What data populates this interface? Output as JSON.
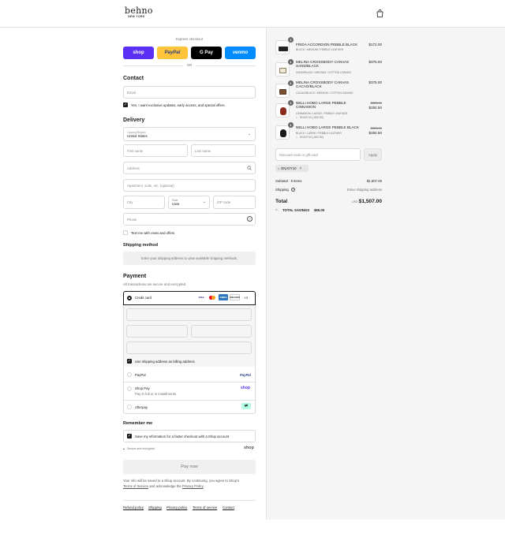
{
  "header": {
    "logo_main": "behno",
    "logo_sub": "NEW YORK",
    "cart_icon": "shopping-bag-icon"
  },
  "express": {
    "title": "Express checkout",
    "buttons": [
      {
        "label": "shop",
        "bg": "#5a31f4",
        "fg": "#ffffff"
      },
      {
        "label": "PayPal",
        "bg": "#ffc439",
        "fg": "#253b80"
      },
      {
        "label": "G Pay",
        "bg": "#000000",
        "fg": "#ffffff"
      },
      {
        "label": "venmo",
        "bg": "#008cff",
        "fg": "#ffffff"
      }
    ],
    "or": "OR"
  },
  "contact": {
    "title": "Contact",
    "email_placeholder": "Email",
    "offers_label": "Yes, I want exclusive updates, early access, and special offers."
  },
  "delivery": {
    "title": "Delivery",
    "country_label": "Country/Region",
    "country_value": "United States",
    "first_name": "First name",
    "last_name": "Last name",
    "address": "Address",
    "apartment": "Apartment, suite, etc. (optional)",
    "city": "City",
    "state_label": "State",
    "state_value": "Iowa",
    "zip": "ZIP code",
    "phone": "Phone",
    "sms_label": "Text me with news and offers"
  },
  "shipping_method": {
    "title": "Shipping method",
    "message": "Enter your shipping address to view available shipping methods."
  },
  "payment": {
    "title": "Payment",
    "subtitle": "All transactions are secure and encrypted.",
    "credit_card": "Credit card",
    "card_logos": [
      "VISA",
      "MC",
      "AMEX",
      "DISCOVER"
    ],
    "more_cards": "+4",
    "billing_label": "Use shipping address as billing address",
    "paypal": "PayPal",
    "paypal_logo": "PayPal",
    "shoppay": "Shop Pay",
    "shoppay_sub": "Pay in full or in installments",
    "shoppay_logo": "shop",
    "afterpay": "Afterpay"
  },
  "remember": {
    "title": "Remember me",
    "save_label": "Save my information for a faster checkout with a Shop account",
    "secure": "Secure and encrypted",
    "shop_logo": "shop"
  },
  "pay_now": "Pay now",
  "legal": {
    "line1": "Your info will be saved to a Shop account. By continuing, you agree to Shop's",
    "terms": "Terms of Service",
    "and": "and acknowledge the",
    "privacy": "Privacy Policy",
    "dot": "."
  },
  "footer": [
    "Refund policy",
    "Shipping",
    "Privacy policy",
    "Terms of service",
    "Contact"
  ],
  "items": [
    {
      "qty": "1",
      "name": "FRIDA ACCORDION PEBBLE BLACK",
      "variant": "BLACK / MEDIUM / PEBBLE LEATHER",
      "price": "$172.00",
      "orig": "",
      "discount": ""
    },
    {
      "qty": "1",
      "name": "MELINA CROSSBODY CANVAS SAND/BLACK",
      "variant": "SAND/BLACK / MEDIUM / COTTON CANVAS",
      "price": "$375.00",
      "orig": "",
      "discount": ""
    },
    {
      "qty": "1",
      "name": "MELINA CROSSBODY CANVAS CACAO/BLACK",
      "variant": "CACAO/BLACK / MEDIUM / COTTON CANVAS",
      "price": "$375.00",
      "orig": "",
      "discount": ""
    },
    {
      "qty": "1",
      "name": "NELLI HOBO LARGE PEBBLE CINNAMON",
      "variant": "CINNAMON / LARGE / PEBBLE LEATHER",
      "price": "$292.50",
      "orig": "$325.00",
      "discount": "ENJOY10 (-$32.50)"
    },
    {
      "qty": "1",
      "name": "NELLI HOBO LARGE PEBBLE BLACK",
      "variant": "BLACK / LARGE / PEBBLE LEATHER",
      "price": "$292.50",
      "orig": "$325.00",
      "discount": "ENJOY10 (-$32.50)"
    }
  ],
  "discount": {
    "placeholder": "Discount code or gift card",
    "apply": "Apply",
    "tag": "ENJOY10"
  },
  "summary": {
    "subtotal_label": "Subtotal · 5 items",
    "subtotal": "$1,507.00",
    "shipping_label": "Shipping",
    "shipping_value": "Enter shipping address",
    "total_label": "Total",
    "currency": "USD",
    "total": "$1,507.00",
    "savings_label": "TOTAL SAVINGS",
    "savings": "$65.00"
  }
}
